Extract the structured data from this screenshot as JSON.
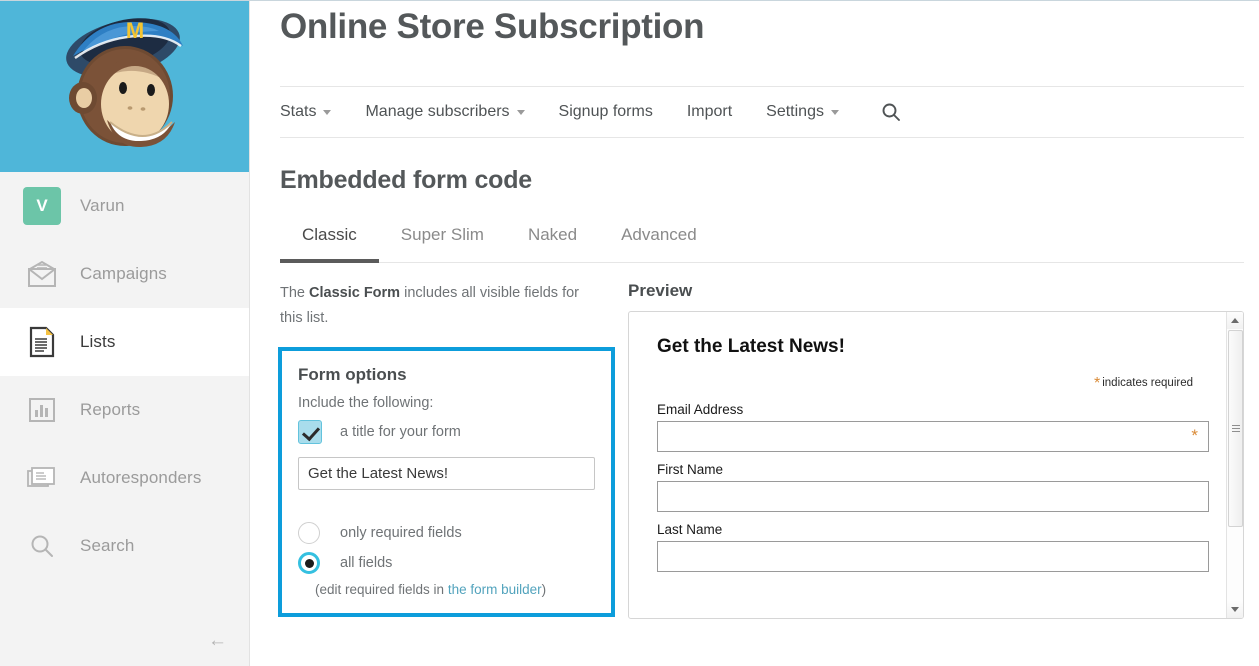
{
  "sidebar": {
    "logo_icon": "mailchimp-freddie-logo",
    "account": {
      "initial": "V",
      "name": "Varun"
    },
    "items": [
      {
        "label": "Campaigns",
        "icon": "envelope-icon",
        "active": false
      },
      {
        "label": "Lists",
        "icon": "list-document-icon",
        "active": true
      },
      {
        "label": "Reports",
        "icon": "bar-chart-icon",
        "active": false
      },
      {
        "label": "Autoresponders",
        "icon": "autoresponder-icon",
        "active": false
      },
      {
        "label": "Search",
        "icon": "search-icon",
        "active": false
      }
    ],
    "collapse_arrow": "←"
  },
  "header": {
    "title": "Online Store Subscription"
  },
  "topnav": {
    "items": [
      {
        "label": "Stats",
        "caret": true
      },
      {
        "label": "Manage subscribers",
        "caret": true
      },
      {
        "label": "Signup forms",
        "caret": false
      },
      {
        "label": "Import",
        "caret": false
      },
      {
        "label": "Settings",
        "caret": true
      }
    ],
    "search_icon": "search-icon"
  },
  "section": {
    "title": "Embedded form code",
    "tabs": [
      {
        "label": "Classic",
        "active": true
      },
      {
        "label": "Super Slim",
        "active": false
      },
      {
        "label": "Naked",
        "active": false
      },
      {
        "label": "Advanced",
        "active": false
      }
    ],
    "description_pre": "The ",
    "description_bold": "Classic Form",
    "description_post": " includes all visible fields for this list."
  },
  "form_options": {
    "title": "Form options",
    "subtitle": "Include the following:",
    "checkbox_label": "a title for your form",
    "checkbox_checked": true,
    "title_input_value": "Get the Latest News!",
    "title_input_placeholder": "Form title",
    "radios": [
      {
        "label": "only required fields",
        "checked": false
      },
      {
        "label": "all fields",
        "checked": true
      }
    ],
    "hint_pre": "(edit required fields in ",
    "hint_link": "the form builder",
    "hint_post": ")",
    "highlight_color": "#0d9ddb"
  },
  "preview": {
    "title": "Preview",
    "form_heading": "Get the Latest News!",
    "required_note": "indicates required",
    "required_marker": "*",
    "fields": [
      {
        "label": "Email Address",
        "value": "",
        "required": true
      },
      {
        "label": "First Name",
        "value": "",
        "required": false
      },
      {
        "label": "Last Name",
        "value": "",
        "required": false
      }
    ],
    "scrollbar": {
      "up_icon": "scroll-up-arrow-icon",
      "down_icon": "scroll-down-arrow-icon"
    }
  },
  "colors": {
    "brand_blue": "#4fb6d9",
    "highlight": "#0d9ddb",
    "avatar_green": "#6cc5a8",
    "required_orange": "#d98a36",
    "link_teal": "#52a3bd"
  }
}
